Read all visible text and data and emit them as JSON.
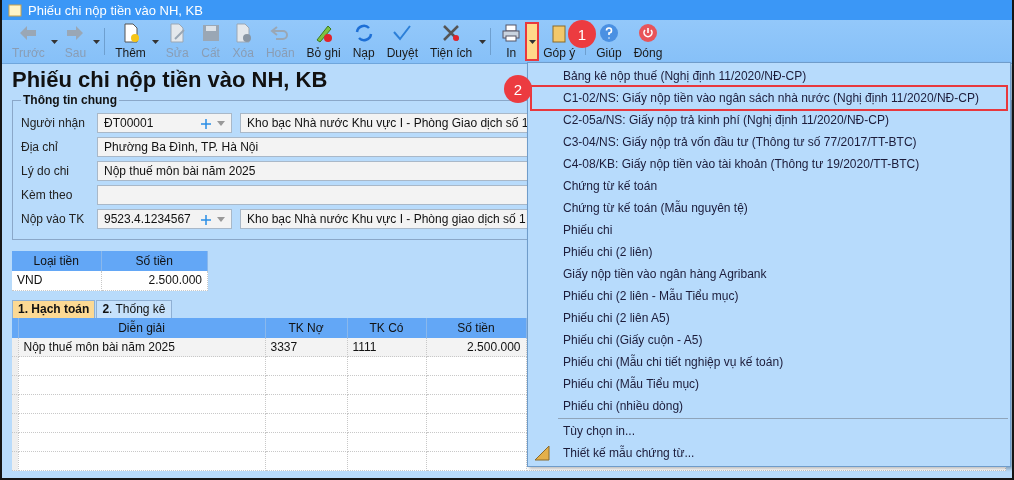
{
  "window": {
    "title": "Phiếu chi nộp tiền vào NH, KB"
  },
  "toolbar": {
    "items": [
      {
        "kind": "button",
        "label": "Trước",
        "disabled": true,
        "dropdown": true
      },
      {
        "kind": "button",
        "label": "Sau",
        "disabled": true,
        "dropdown": true
      },
      {
        "kind": "separator"
      },
      {
        "kind": "button",
        "label": "Thêm",
        "disabled": false,
        "dropdown": true
      },
      {
        "kind": "button",
        "label": "Sửa",
        "disabled": true,
        "dropdown": false
      },
      {
        "kind": "button",
        "label": "Cất",
        "disabled": true,
        "dropdown": false
      },
      {
        "kind": "button",
        "label": "Xóa",
        "disabled": true,
        "dropdown": false
      },
      {
        "kind": "button",
        "label": "Hoãn",
        "disabled": true,
        "dropdown": false
      },
      {
        "kind": "button",
        "label": "Bỏ ghi",
        "disabled": false,
        "dropdown": false
      },
      {
        "kind": "button",
        "label": "Nạp",
        "disabled": false,
        "dropdown": false
      },
      {
        "kind": "button",
        "label": "Duyệt",
        "disabled": false,
        "dropdown": false
      },
      {
        "kind": "button",
        "label": "Tiện ích",
        "disabled": false,
        "dropdown": true
      },
      {
        "kind": "separator"
      },
      {
        "kind": "split",
        "label": "In",
        "disabled": false,
        "open": true,
        "annotated": true
      },
      {
        "kind": "button",
        "label": "Góp ý",
        "disabled": false,
        "dropdown": false
      },
      {
        "kind": "separator"
      },
      {
        "kind": "button",
        "label": "Giúp",
        "disabled": false,
        "dropdown": false
      },
      {
        "kind": "button",
        "label": "Đóng",
        "disabled": false,
        "dropdown": false
      }
    ]
  },
  "form_title": "Phiếu chi nộp tiền vào NH, KB",
  "general_info": {
    "legend": "Thông tin chung",
    "fields": [
      {
        "label": "Người nhận",
        "kind": "combo",
        "value": "ĐT00001",
        "name_value": "Kho bạc Nhà nước Khu vực I - Phòng Giao dịch số 1"
      },
      {
        "label": "Địa chỉ",
        "kind": "text",
        "value": "Phường Ba Đình, TP. Hà Nội"
      },
      {
        "label": "Lý do chi",
        "kind": "text",
        "value": "Nộp thuế môn bài năm 2025"
      },
      {
        "label": "Kèm theo",
        "kind": "text"
      },
      {
        "label": "Nộp vào TK",
        "kind": "combo",
        "value": "9523.4.1234567",
        "name_value": "Kho bạc Nhà nước Khu vực I - Phòng giao dịch số 1"
      }
    ]
  },
  "currency_table": {
    "columns": [
      "Loại tiền",
      "Số tiền"
    ],
    "rows": [
      [
        "VND",
        "2.500.000"
      ]
    ]
  },
  "tabs": [
    {
      "label": "**1**. Hạch toán",
      "selected": true
    },
    {
      "label": "**2**. Thống kê",
      "selected": false
    }
  ],
  "grid": {
    "columns": [
      "Diễn giải",
      "TK Nợ",
      "TK Có",
      "Số tiền"
    ],
    "rows": [
      [
        "Nộp thuế môn bài năm 2025",
        "3337",
        "1111",
        "2.500.000"
      ]
    ]
  },
  "print_menu": {
    "items": [
      {
        "kind": "option",
        "label": "Bảng kê nộp thuế (Nghị định 11/2020/NĐ-CP)",
        "annotated": false
      },
      {
        "kind": "option",
        "label": "C1-02/NS: Giấy nộp tiền vào ngân sách nhà nước (Nghị định 11/2020/NĐ-CP)",
        "annotated": true
      },
      {
        "kind": "option",
        "label": "C2-05a/NS: Giấy nộp trả kinh phí (Nghị định 11/2020/NĐ-CP)",
        "annotated": false
      },
      {
        "kind": "option",
        "label": "C3-04/NS: Giấy nộp trả vốn đầu tư (Thông tư số 77/2017/TT-BTC)",
        "annotated": false
      },
      {
        "kind": "option",
        "label": "C4-08/KB: Giấy nộp tiền vào tài khoản (Thông tư 19/2020/TT-BTC)",
        "annotated": false
      },
      {
        "kind": "option",
        "label": "Chứng từ kế toán",
        "annotated": false
      },
      {
        "kind": "option",
        "label": "Chứng từ kế toán (Mẫu nguyên tệ)",
        "annotated": false
      },
      {
        "kind": "option",
        "label": "Phiếu chi",
        "annotated": false
      },
      {
        "kind": "option",
        "label": "Phiếu chi (2 liên)",
        "annotated": false
      },
      {
        "kind": "option",
        "label": "Giấy nộp tiền vào ngân hàng Agribank",
        "annotated": false
      },
      {
        "kind": "option",
        "label": "Phiếu chi (2 liên - Mẫu Tiểu mục)",
        "annotated": false
      },
      {
        "kind": "option",
        "label": "Phiếu chi (2 liên A5)",
        "annotated": false
      },
      {
        "kind": "option",
        "label": "Phiếu chi (Giấy cuộn - A5)",
        "annotated": false
      },
      {
        "kind": "option",
        "label": "Phiếu chi (Mẫu chi tiết nghiệp vụ kế toán)",
        "annotated": false
      },
      {
        "kind": "option",
        "label": "Phiếu chi (Mẫu Tiểu mục)",
        "annotated": false
      },
      {
        "kind": "option",
        "label": "Phiếu chi (nhiều dòng)",
        "annotated": false
      },
      {
        "kind": "separator"
      },
      {
        "kind": "command",
        "label": "Tùy chọn in...",
        "annotated": false
      },
      {
        "kind": "designer",
        "label": "Thiết kế mẫu chứng từ...",
        "annotated": false
      }
    ]
  },
  "step_badges": [
    "1",
    "2"
  ]
}
